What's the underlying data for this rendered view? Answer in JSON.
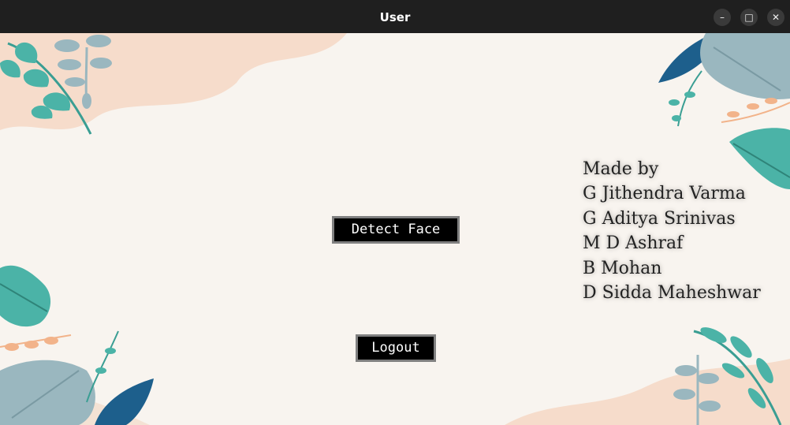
{
  "window": {
    "title": "User",
    "controls": {
      "minimize": "–",
      "maximize": "□",
      "close": "✕"
    }
  },
  "main": {
    "detect_face_label": "Detect Face",
    "logout_label": "Logout"
  },
  "credits": {
    "heading": "Made by",
    "names": [
      "G Jithendra Varma",
      "G Aditya Srinivas",
      "M D Ashraf",
      "B Mohan",
      "D Sidda Maheshwar"
    ]
  },
  "colors": {
    "titlebar": "#1f1f1f",
    "background": "#f8f4ef",
    "blob": "#f6dccb",
    "teal_leaf": "#4bb3a7",
    "navy_leaf": "#1d5f8c",
    "grey_leaf": "#9ab7bf",
    "peach_leaf": "#f2b38a"
  }
}
